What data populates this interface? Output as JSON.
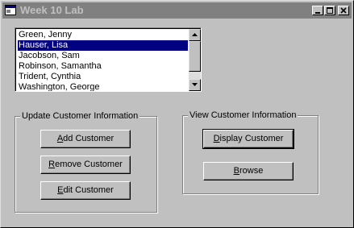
{
  "window": {
    "title": "Week 10 Lab",
    "controls": [
      "minimize-icon",
      "maximize-icon",
      "close-icon"
    ]
  },
  "customer_list": {
    "items": [
      {
        "label": "Green, Jenny",
        "selected": false
      },
      {
        "label": "Hauser, Lisa",
        "selected": true
      },
      {
        "label": "Jacobson, Sam",
        "selected": false
      },
      {
        "label": "Robinson, Samantha",
        "selected": false
      },
      {
        "label": "Trident, Cynthia",
        "selected": false
      },
      {
        "label": "Washington, George",
        "selected": false
      }
    ]
  },
  "update_group": {
    "label": "Update Customer Information",
    "add_button": {
      "accel": "A",
      "rest": "dd Customer"
    },
    "remove_button": {
      "accel": "R",
      "rest": "emove Customer"
    },
    "edit_button": {
      "accel": "E",
      "rest": "dit Customer"
    }
  },
  "view_group": {
    "label": "View Customer Information",
    "display_button": {
      "accel": "D",
      "rest": "isplay Customer"
    },
    "browse_button": {
      "accel": "B",
      "rest": "rowse"
    }
  },
  "colors": {
    "face": "#c0c0c0",
    "inactive_titlebar": "#808080",
    "selection": "#000080"
  }
}
